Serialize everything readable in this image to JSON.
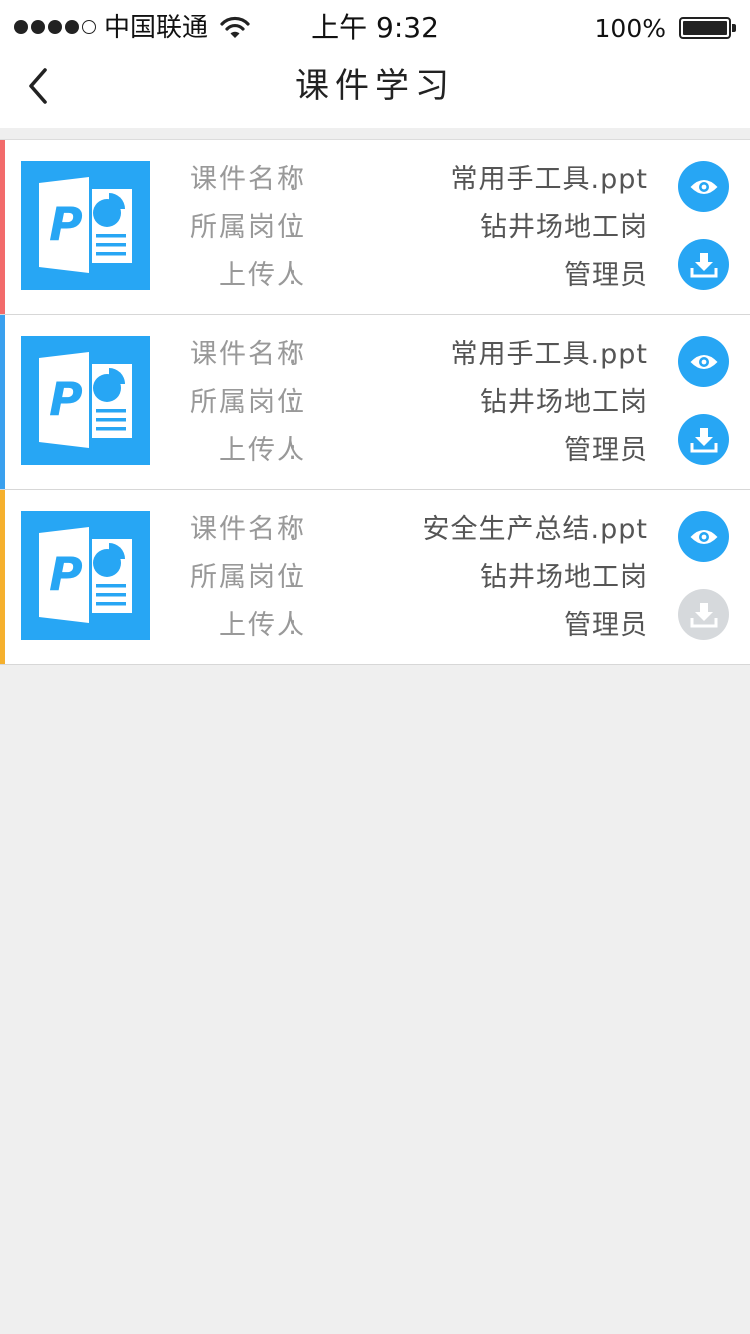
{
  "status_bar": {
    "carrier": "中国联通",
    "time": "上午 9:32",
    "battery": "100%"
  },
  "nav": {
    "title": "课件学习"
  },
  "labels": {
    "name": "课件名称",
    "post": "所属岗位",
    "uploader": "上传人",
    "colon": ":"
  },
  "colors": {
    "primary": "#27a6f4",
    "disabled": "#d6d9dc",
    "card_accents": [
      "#f26b6b",
      "#3aa0ee",
      "#f5b02e"
    ]
  },
  "courseware": [
    {
      "name": "常用手工具.ppt",
      "post": "钻井场地工岗",
      "uploader": "管理员",
      "file_icon": "powerpoint-file-icon",
      "download_enabled": true
    },
    {
      "name": "常用手工具.ppt",
      "post": "钻井场地工岗",
      "uploader": "管理员",
      "file_icon": "powerpoint-file-icon",
      "download_enabled": true
    },
    {
      "name": "安全生产总结.ppt",
      "post": "钻井场地工岗",
      "uploader": "管理员",
      "file_icon": "powerpoint-file-icon",
      "download_enabled": false
    }
  ]
}
